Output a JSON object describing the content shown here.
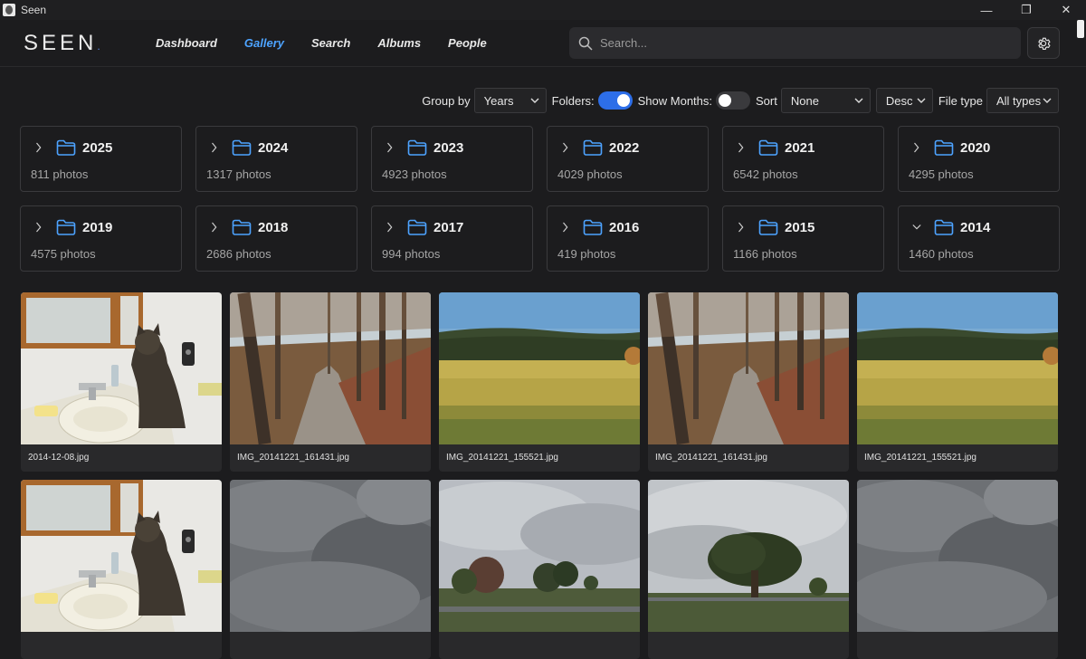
{
  "window": {
    "title": "Seen",
    "min": "—",
    "max": "❐",
    "close": "✕"
  },
  "nav": {
    "logo": "SEEN",
    "logo_dot": ".",
    "links": [
      {
        "label": "Dashboard",
        "active": false
      },
      {
        "label": "Gallery",
        "active": true
      },
      {
        "label": "Search",
        "active": false
      },
      {
        "label": "Albums",
        "active": false
      },
      {
        "label": "People",
        "active": false
      }
    ],
    "search_placeholder": "Search...",
    "accent_color": "#4da3ff"
  },
  "filters": {
    "group_by_label": "Group by",
    "group_by_value": "Years",
    "folders_label": "Folders:",
    "folders_on": true,
    "show_months_label": "Show Months:",
    "show_months_on": false,
    "sort_label": "Sort",
    "sort_value": "None",
    "order_value": "Desc",
    "file_type_label": "File type",
    "file_type_value": "All types"
  },
  "folders": [
    {
      "year": "2025",
      "count": "811 photos",
      "expanded": false
    },
    {
      "year": "2024",
      "count": "1317 photos",
      "expanded": false
    },
    {
      "year": "2023",
      "count": "4923 photos",
      "expanded": false
    },
    {
      "year": "2022",
      "count": "4029 photos",
      "expanded": false
    },
    {
      "year": "2021",
      "count": "6542 photos",
      "expanded": false
    },
    {
      "year": "2020",
      "count": "4295 photos",
      "expanded": false
    },
    {
      "year": "2019",
      "count": "4575 photos",
      "expanded": false
    },
    {
      "year": "2018",
      "count": "2686 photos",
      "expanded": false
    },
    {
      "year": "2017",
      "count": "994 photos",
      "expanded": false
    },
    {
      "year": "2016",
      "count": "419 photos",
      "expanded": false
    },
    {
      "year": "2015",
      "count": "1166 photos",
      "expanded": false
    },
    {
      "year": "2014",
      "count": "1460 photos",
      "expanded": true
    }
  ],
  "photos": [
    {
      "name": "2014-12-08.jpg",
      "scene": "cat"
    },
    {
      "name": "IMG_20141221_161431.jpg",
      "scene": "forest"
    },
    {
      "name": "IMG_20141221_155521.jpg",
      "scene": "field"
    },
    {
      "name": "IMG_20141221_161431.jpg",
      "scene": "forest"
    },
    {
      "name": "IMG_20141221_155521.jpg",
      "scene": "field"
    },
    {
      "name": "",
      "scene": "cat"
    },
    {
      "name": "",
      "scene": "clouds"
    },
    {
      "name": "",
      "scene": "trees"
    },
    {
      "name": "",
      "scene": "bigtree"
    },
    {
      "name": "",
      "scene": "clouds"
    }
  ]
}
